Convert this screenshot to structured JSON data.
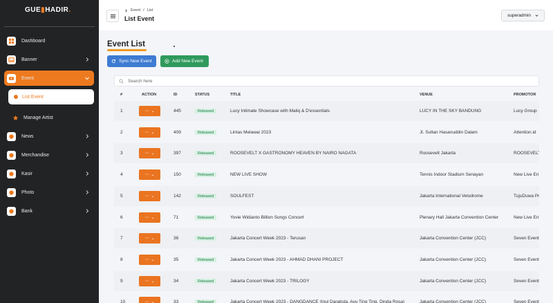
{
  "app": {
    "logo_text": "GUE",
    "logo_text2": "HADIR",
    "logo_suffix": "."
  },
  "sidebar": {
    "items": [
      {
        "label": "Dashboard",
        "icon": "dashboard-icon"
      },
      {
        "label": "Banner",
        "icon": "image-icon"
      },
      {
        "label": "Event",
        "icon": "ticket-icon"
      },
      {
        "label": "News",
        "icon": "news-icon"
      },
      {
        "label": "Merchandise",
        "icon": "bag-icon"
      },
      {
        "label": "Kasir",
        "icon": "cashier-icon"
      },
      {
        "label": "Photo",
        "icon": "photo-icon"
      },
      {
        "label": "Bank",
        "icon": "bank-icon"
      }
    ],
    "event_sub": [
      {
        "label": "List Event"
      },
      {
        "label": "Manage Artist"
      }
    ]
  },
  "topbar": {
    "breadcrumb": [
      "Event",
      "/",
      "List"
    ],
    "page_title": "List Event",
    "user": "superadmin"
  },
  "main": {
    "title": "Event List",
    "sync_label": "Sync New Event",
    "add_label": "Add New Event",
    "search_placeholder": "Search here",
    "columns": [
      "#",
      "ACTION",
      "ID",
      "STATUS",
      "TITLE",
      "VENUE",
      "PROMOTOR"
    ],
    "rows": [
      {
        "no": "1",
        "id": "445",
        "status": "Released",
        "title": "Lucy Intimate Showcase with Maliq & D'essentials",
        "venue": "LUCY IN THE SKY BANDUNG",
        "promotor": "Lucy Group"
      },
      {
        "no": "2",
        "id": "409",
        "status": "Released",
        "title": "Lintas Melawai 2023",
        "venue": "Jl. Sultan Hasanuddin Dalam",
        "promotor": "Attention.id"
      },
      {
        "no": "3",
        "id": "397",
        "status": "Released",
        "title": "ROOSEVELT X GASTRONOMY HEAVEN BY NAIRO NAGATA",
        "venue": "Roosevelt Jakarta",
        "promotor": "ROOSEVELT"
      },
      {
        "no": "4",
        "id": "150",
        "status": "Released",
        "title": "NEW LIVE SHOW",
        "venue": "Tennis Indoor Stadium Senayan",
        "promotor": "New Live Ent"
      },
      {
        "no": "5",
        "id": "142",
        "status": "Released",
        "title": "SOULFEST",
        "venue": "Jakarta International Velodrome",
        "promotor": "TujuDuwa Pro"
      },
      {
        "no": "6",
        "id": "71",
        "status": "Released",
        "title": "Yovie Widianto Billion Songs Concert",
        "venue": "Plenary Hall Jakarta Convention Center",
        "promotor": "New Live Ent"
      },
      {
        "no": "7",
        "id": "36",
        "status": "Released",
        "title": "Jakarta Concert Week 2023 - Terusan",
        "venue": "Jakarta Convention Center (JCC)",
        "promotor": "Seven Event"
      },
      {
        "no": "8",
        "id": "35",
        "status": "Released",
        "title": "Jakarta Concert Week 2023 - AHMAD DHANI PROJECT",
        "venue": "Jakarta Convention Center (JCC)",
        "promotor": "Seven Event"
      },
      {
        "no": "9",
        "id": "34",
        "status": "Released",
        "title": "Jakarta Concert Week 2023 - TRILOGY",
        "venue": "Jakarta Convention Center (JCC)",
        "promotor": "Seven Event"
      },
      {
        "no": "10",
        "id": "33",
        "status": "Released",
        "title": "Jakarta Concert Week 2023 - DANGDANCE (Inul Daratista, Ayu Ting Ting, Dinda Rosa)",
        "venue": "Jakarta Convention Center (JCC)",
        "promotor": "Seven Event"
      }
    ],
    "action_symbol": "⋯",
    "action_chevron": "⌄"
  },
  "colors": {
    "accent": "#ee7a1f",
    "sidebar_bg": "#212325",
    "sync": "#3e7bd2",
    "add": "#2f9a5c",
    "badge_bg": "#d6f1e1",
    "badge_text": "#1f7a45"
  }
}
